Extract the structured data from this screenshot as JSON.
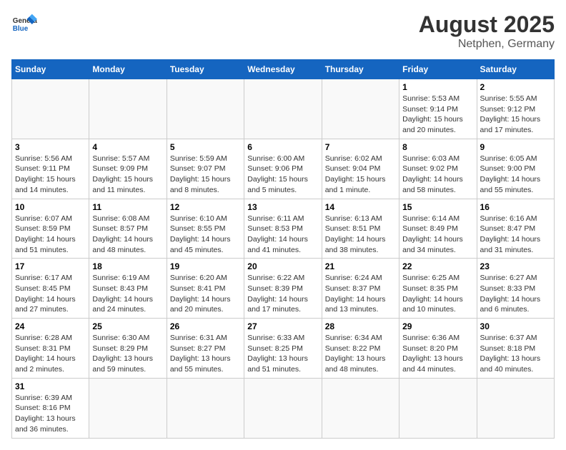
{
  "header": {
    "logo_general": "General",
    "logo_blue": "Blue",
    "title": "August 2025",
    "subtitle": "Netphen, Germany"
  },
  "weekdays": [
    "Sunday",
    "Monday",
    "Tuesday",
    "Wednesday",
    "Thursday",
    "Friday",
    "Saturday"
  ],
  "weeks": [
    [
      {
        "day": "",
        "info": ""
      },
      {
        "day": "",
        "info": ""
      },
      {
        "day": "",
        "info": ""
      },
      {
        "day": "",
        "info": ""
      },
      {
        "day": "",
        "info": ""
      },
      {
        "day": "1",
        "info": "Sunrise: 5:53 AM\nSunset: 9:14 PM\nDaylight: 15 hours\nand 20 minutes."
      },
      {
        "day": "2",
        "info": "Sunrise: 5:55 AM\nSunset: 9:12 PM\nDaylight: 15 hours\nand 17 minutes."
      }
    ],
    [
      {
        "day": "3",
        "info": "Sunrise: 5:56 AM\nSunset: 9:11 PM\nDaylight: 15 hours\nand 14 minutes."
      },
      {
        "day": "4",
        "info": "Sunrise: 5:57 AM\nSunset: 9:09 PM\nDaylight: 15 hours\nand 11 minutes."
      },
      {
        "day": "5",
        "info": "Sunrise: 5:59 AM\nSunset: 9:07 PM\nDaylight: 15 hours\nand 8 minutes."
      },
      {
        "day": "6",
        "info": "Sunrise: 6:00 AM\nSunset: 9:06 PM\nDaylight: 15 hours\nand 5 minutes."
      },
      {
        "day": "7",
        "info": "Sunrise: 6:02 AM\nSunset: 9:04 PM\nDaylight: 15 hours\nand 1 minute."
      },
      {
        "day": "8",
        "info": "Sunrise: 6:03 AM\nSunset: 9:02 PM\nDaylight: 14 hours\nand 58 minutes."
      },
      {
        "day": "9",
        "info": "Sunrise: 6:05 AM\nSunset: 9:00 PM\nDaylight: 14 hours\nand 55 minutes."
      }
    ],
    [
      {
        "day": "10",
        "info": "Sunrise: 6:07 AM\nSunset: 8:59 PM\nDaylight: 14 hours\nand 51 minutes."
      },
      {
        "day": "11",
        "info": "Sunrise: 6:08 AM\nSunset: 8:57 PM\nDaylight: 14 hours\nand 48 minutes."
      },
      {
        "day": "12",
        "info": "Sunrise: 6:10 AM\nSunset: 8:55 PM\nDaylight: 14 hours\nand 45 minutes."
      },
      {
        "day": "13",
        "info": "Sunrise: 6:11 AM\nSunset: 8:53 PM\nDaylight: 14 hours\nand 41 minutes."
      },
      {
        "day": "14",
        "info": "Sunrise: 6:13 AM\nSunset: 8:51 PM\nDaylight: 14 hours\nand 38 minutes."
      },
      {
        "day": "15",
        "info": "Sunrise: 6:14 AM\nSunset: 8:49 PM\nDaylight: 14 hours\nand 34 minutes."
      },
      {
        "day": "16",
        "info": "Sunrise: 6:16 AM\nSunset: 8:47 PM\nDaylight: 14 hours\nand 31 minutes."
      }
    ],
    [
      {
        "day": "17",
        "info": "Sunrise: 6:17 AM\nSunset: 8:45 PM\nDaylight: 14 hours\nand 27 minutes."
      },
      {
        "day": "18",
        "info": "Sunrise: 6:19 AM\nSunset: 8:43 PM\nDaylight: 14 hours\nand 24 minutes."
      },
      {
        "day": "19",
        "info": "Sunrise: 6:20 AM\nSunset: 8:41 PM\nDaylight: 14 hours\nand 20 minutes."
      },
      {
        "day": "20",
        "info": "Sunrise: 6:22 AM\nSunset: 8:39 PM\nDaylight: 14 hours\nand 17 minutes."
      },
      {
        "day": "21",
        "info": "Sunrise: 6:24 AM\nSunset: 8:37 PM\nDaylight: 14 hours\nand 13 minutes."
      },
      {
        "day": "22",
        "info": "Sunrise: 6:25 AM\nSunset: 8:35 PM\nDaylight: 14 hours\nand 10 minutes."
      },
      {
        "day": "23",
        "info": "Sunrise: 6:27 AM\nSunset: 8:33 PM\nDaylight: 14 hours\nand 6 minutes."
      }
    ],
    [
      {
        "day": "24",
        "info": "Sunrise: 6:28 AM\nSunset: 8:31 PM\nDaylight: 14 hours\nand 2 minutes."
      },
      {
        "day": "25",
        "info": "Sunrise: 6:30 AM\nSunset: 8:29 PM\nDaylight: 13 hours\nand 59 minutes."
      },
      {
        "day": "26",
        "info": "Sunrise: 6:31 AM\nSunset: 8:27 PM\nDaylight: 13 hours\nand 55 minutes."
      },
      {
        "day": "27",
        "info": "Sunrise: 6:33 AM\nSunset: 8:25 PM\nDaylight: 13 hours\nand 51 minutes."
      },
      {
        "day": "28",
        "info": "Sunrise: 6:34 AM\nSunset: 8:22 PM\nDaylight: 13 hours\nand 48 minutes."
      },
      {
        "day": "29",
        "info": "Sunrise: 6:36 AM\nSunset: 8:20 PM\nDaylight: 13 hours\nand 44 minutes."
      },
      {
        "day": "30",
        "info": "Sunrise: 6:37 AM\nSunset: 8:18 PM\nDaylight: 13 hours\nand 40 minutes."
      }
    ],
    [
      {
        "day": "31",
        "info": "Sunrise: 6:39 AM\nSunset: 8:16 PM\nDaylight: 13 hours\nand 36 minutes."
      },
      {
        "day": "",
        "info": ""
      },
      {
        "day": "",
        "info": ""
      },
      {
        "day": "",
        "info": ""
      },
      {
        "day": "",
        "info": ""
      },
      {
        "day": "",
        "info": ""
      },
      {
        "day": "",
        "info": ""
      }
    ]
  ]
}
